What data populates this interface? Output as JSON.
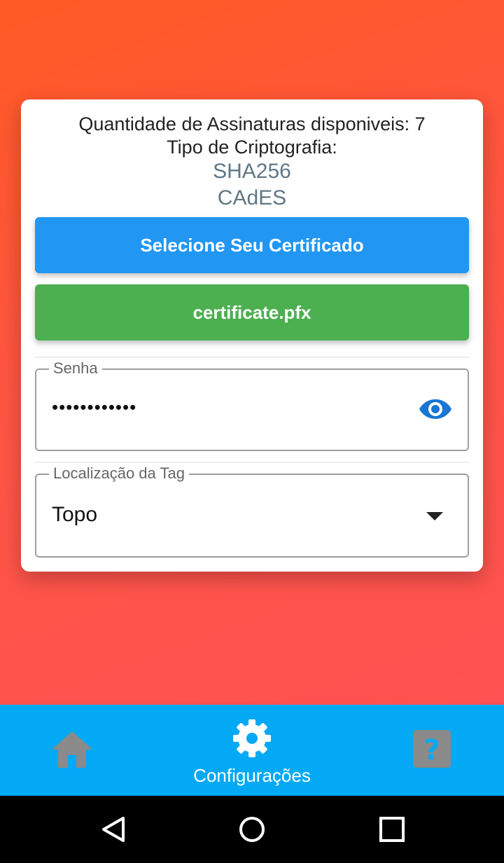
{
  "info": {
    "quantity_text": "Quantidade de Assinaturas disponiveis: 7",
    "crypto_label": "Tipo de Criptografia:",
    "algorithms": [
      "SHA256",
      "CAdES"
    ]
  },
  "buttons": {
    "select_certificate": "Selecione Seu Certificado",
    "certificate_file": "certificate.pfx"
  },
  "password_field": {
    "label": "Senha",
    "value": "••••••••••••"
  },
  "tag_location_field": {
    "label": "Localização da Tag",
    "selected": "Topo"
  },
  "bottom_nav": {
    "items": [
      {
        "icon": "home-icon"
      },
      {
        "icon": "gear-icon",
        "label": "Configurações",
        "active": true
      },
      {
        "icon": "help-icon"
      }
    ]
  },
  "colors": {
    "primary_button": "#2196f3",
    "file_button": "#4caf50",
    "nav_bar": "#03a9f4",
    "background_gradient_start": "#ff5a24",
    "background_gradient_end": "#ff5252"
  }
}
